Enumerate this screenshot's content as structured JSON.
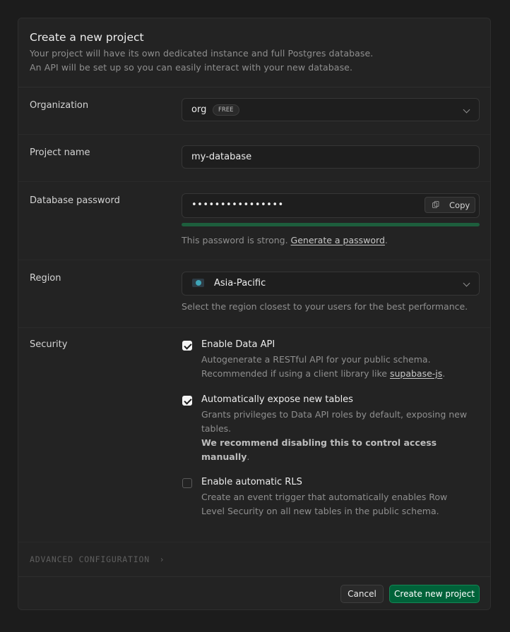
{
  "header": {
    "title": "Create a new project",
    "subtitle_line1": "Your project will have its own dedicated instance and full Postgres database.",
    "subtitle_line2": "An API will be set up so you can easily interact with your new database."
  },
  "organization": {
    "label": "Organization",
    "value": "org",
    "badge": "FREE"
  },
  "project_name": {
    "label": "Project name",
    "value": "my-database"
  },
  "database_password": {
    "label": "Database password",
    "value": "••••••••••••••••",
    "copy_label": "Copy",
    "strength": 1.0,
    "strength_color": "#1d5e3d",
    "help_text": "This password is strong.",
    "help_link": "Generate a password",
    "help_end": "."
  },
  "region": {
    "label": "Region",
    "value": "Asia-Pacific",
    "help_text": "Select the region closest to your users for the best performance."
  },
  "security": {
    "label": "Security",
    "options": [
      {
        "title": "Enable Data API",
        "checked": true,
        "desc_line1": "Autogenerate a RESTful API for your public schema.",
        "desc_line2_prefix": "Recommended if using a client library like",
        "desc_link": "supabase-js",
        "desc_line2_suffix": "."
      },
      {
        "title": "Automatically expose new tables",
        "checked": true,
        "desc_line1": "Grants privileges to Data API roles by default, exposing new",
        "desc_line2": "tables.",
        "desc_bold1": "We recommend disabling this to control access",
        "desc_bold2": "manually",
        "desc_bold_suffix": "."
      },
      {
        "title": "Enable automatic RLS",
        "checked": false,
        "desc_line1": "Create an event trigger that automatically enables Row",
        "desc_line2": "Level Security on all new tables in the public schema."
      }
    ]
  },
  "advanced": {
    "label": "ADVANCED CONFIGURATION",
    "chevron": "›"
  },
  "footer": {
    "cancel_label": "Cancel",
    "create_label": "Create new project"
  },
  "colors": {
    "accent": "#006239",
    "background": "#1c1c1c",
    "card": "#232323"
  }
}
